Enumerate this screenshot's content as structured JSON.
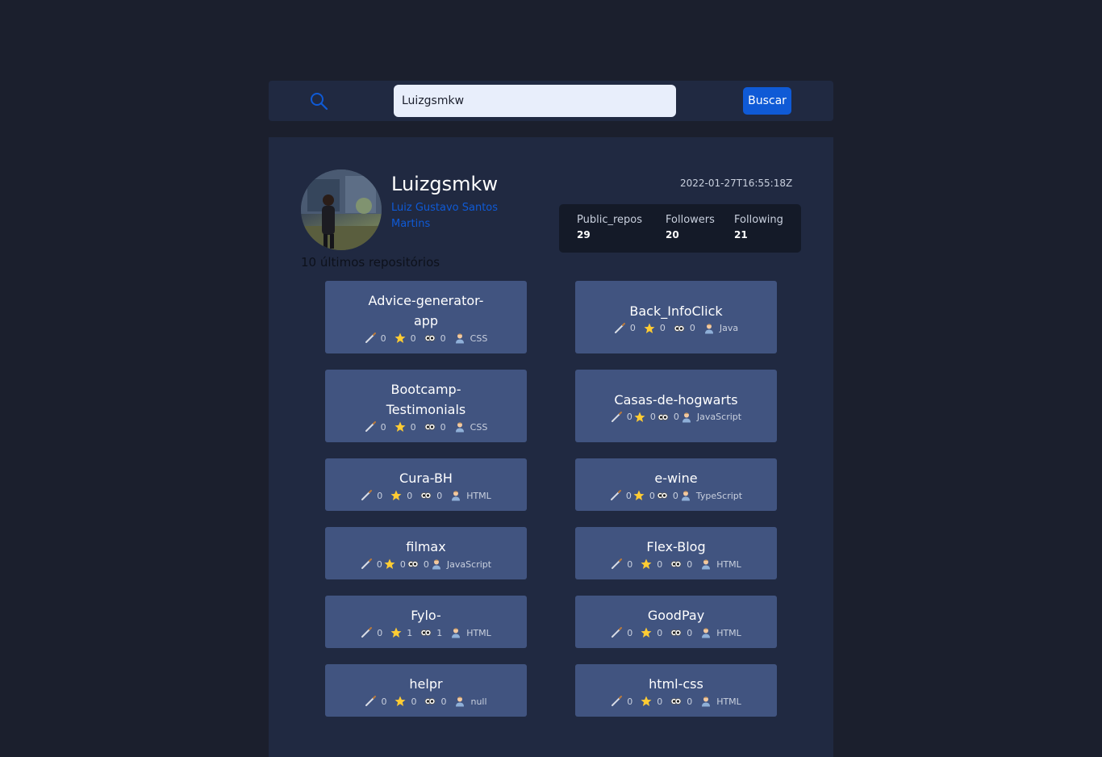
{
  "search": {
    "value": "Luizgsmkw",
    "button_label": "Buscar"
  },
  "profile": {
    "login": "Luizgsmkw",
    "name": "Luiz Gustavo Santos Martins",
    "created_at": "2022-01-27T16:55:18Z",
    "stats": [
      {
        "label": "Public_repos",
        "value": "29"
      },
      {
        "label": "Followers",
        "value": "20"
      },
      {
        "label": "Following",
        "value": "21"
      }
    ]
  },
  "repos_title": "10 últimos repositórios",
  "icons": {
    "forks": "pen-icon",
    "stars": "star-icon",
    "watchers": "eyes-icon",
    "language": "person-icon"
  },
  "colors": {
    "accent": "#0f5ad6",
    "card": "#415480",
    "panel": "#202941",
    "background": "#1b1f2d"
  },
  "repos": [
    {
      "name": "Advice-generator-app",
      "forks": "0",
      "stars": "0",
      "watchers": "0",
      "language": "CSS"
    },
    {
      "name": "Back_InfoClick",
      "forks": "0",
      "stars": "0",
      "watchers": "0",
      "language": "Java"
    },
    {
      "name": "Bootcamp-Testimonials",
      "forks": "0",
      "stars": "0",
      "watchers": "0",
      "language": "CSS"
    },
    {
      "name": "Casas-de-hogwarts",
      "forks": "0",
      "stars": "0",
      "watchers": "0",
      "language": "JavaScript"
    },
    {
      "name": "Cura-BH",
      "forks": "0",
      "stars": "0",
      "watchers": "0",
      "language": "HTML"
    },
    {
      "name": "e-wine",
      "forks": "0",
      "stars": "0",
      "watchers": "0",
      "language": "TypeScript"
    },
    {
      "name": "filmax",
      "forks": "0",
      "stars": "0",
      "watchers": "0",
      "language": "JavaScript"
    },
    {
      "name": "Flex-Blog",
      "forks": "0",
      "stars": "0",
      "watchers": "0",
      "language": "HTML"
    },
    {
      "name": "Fylo-",
      "forks": "0",
      "stars": "1",
      "watchers": "1",
      "language": "HTML"
    },
    {
      "name": "GoodPay",
      "forks": "0",
      "stars": "0",
      "watchers": "0",
      "language": "HTML"
    },
    {
      "name": "helpr",
      "forks": "0",
      "stars": "0",
      "watchers": "0",
      "language": "null"
    },
    {
      "name": "html-css",
      "forks": "0",
      "stars": "0",
      "watchers": "0",
      "language": "HTML"
    }
  ]
}
